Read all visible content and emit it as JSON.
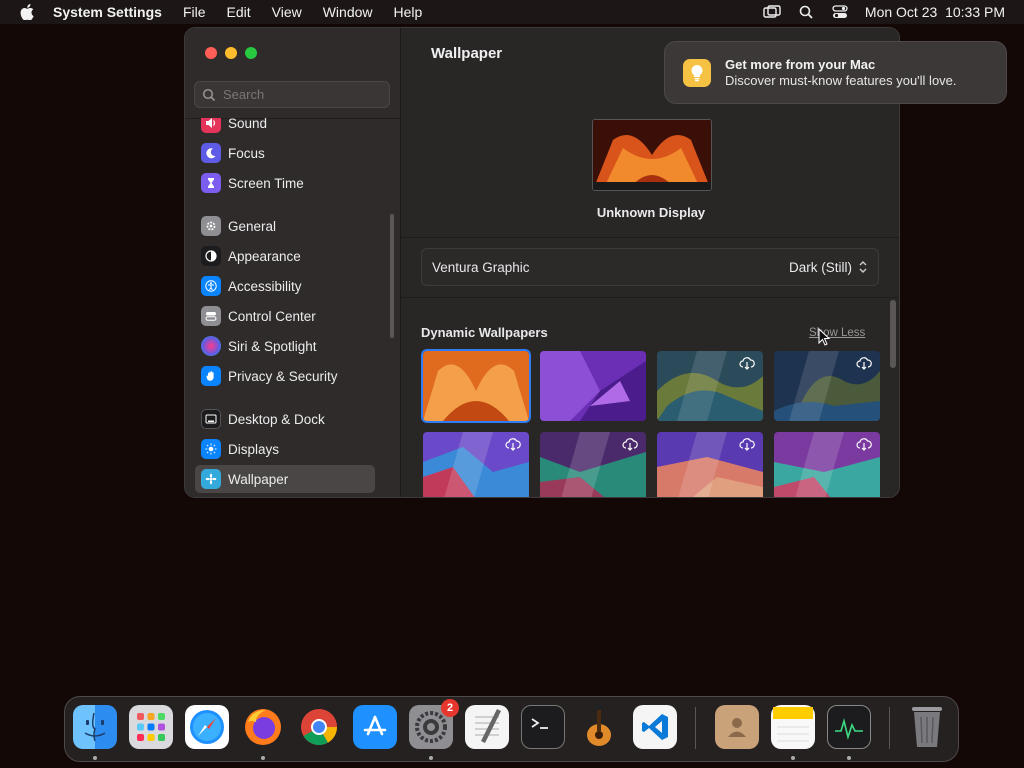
{
  "menubar": {
    "app_name": "System Settings",
    "menus": [
      "File",
      "Edit",
      "View",
      "Window",
      "Help"
    ],
    "datetime": "Mon Oct 23  10:33 PM"
  },
  "sidebar": {
    "search_placeholder": "Search",
    "items": [
      {
        "label": "Sound",
        "icon": "sound-icon",
        "color": "#e5345a"
      },
      {
        "label": "Focus",
        "icon": "moon-icon",
        "color": "#5e5ce6"
      },
      {
        "label": "Screen Time",
        "icon": "hourglass-icon",
        "color": "#7d5cf0"
      },
      {
        "label": "General",
        "icon": "gear-icon",
        "color": "#8e8e93"
      },
      {
        "label": "Appearance",
        "icon": "appearance-icon",
        "color": "#1c1c1e"
      },
      {
        "label": "Accessibility",
        "icon": "accessibility-icon",
        "color": "#0a84ff"
      },
      {
        "label": "Control Center",
        "icon": "control-center-icon",
        "color": "#8e8e93"
      },
      {
        "label": "Siri & Spotlight",
        "icon": "siri-icon",
        "color": "#bf5af2"
      },
      {
        "label": "Privacy & Security",
        "icon": "hand-icon",
        "color": "#0a84ff"
      },
      {
        "label": "Desktop & Dock",
        "icon": "desktop-icon",
        "color": "#1c1c1e"
      },
      {
        "label": "Displays",
        "icon": "sun-icon",
        "color": "#0a84ff"
      },
      {
        "label": "Wallpaper",
        "icon": "wallpaper-icon",
        "color": "#34aadc"
      }
    ],
    "selected": "Wallpaper"
  },
  "main": {
    "title": "Wallpaper",
    "display_label": "Unknown Display",
    "wallpaper_name": "Ventura Graphic",
    "wallpaper_mode": "Dark (Still)",
    "section_title": "Dynamic Wallpapers",
    "show_less": "Show Less"
  },
  "notification": {
    "title": "Get more from your Mac",
    "subtitle": "Discover must-know features you'll love."
  },
  "dock": {
    "items": [
      "finder-icon",
      "launchpad-icon",
      "safari-icon",
      "firefox-icon",
      "chrome-icon",
      "app-store-icon",
      "system-settings-icon",
      "textedit-icon",
      "terminal-icon",
      "garageband-icon",
      "vscode-icon",
      "contacts-icon",
      "notes-icon",
      "activity-monitor-icon",
      "trash-icon"
    ],
    "system_settings_badge": "2"
  },
  "colors": {
    "accent": "#2e7cf6",
    "close": "#ff5f57",
    "minimize": "#febc2e",
    "zoom": "#28c840"
  }
}
